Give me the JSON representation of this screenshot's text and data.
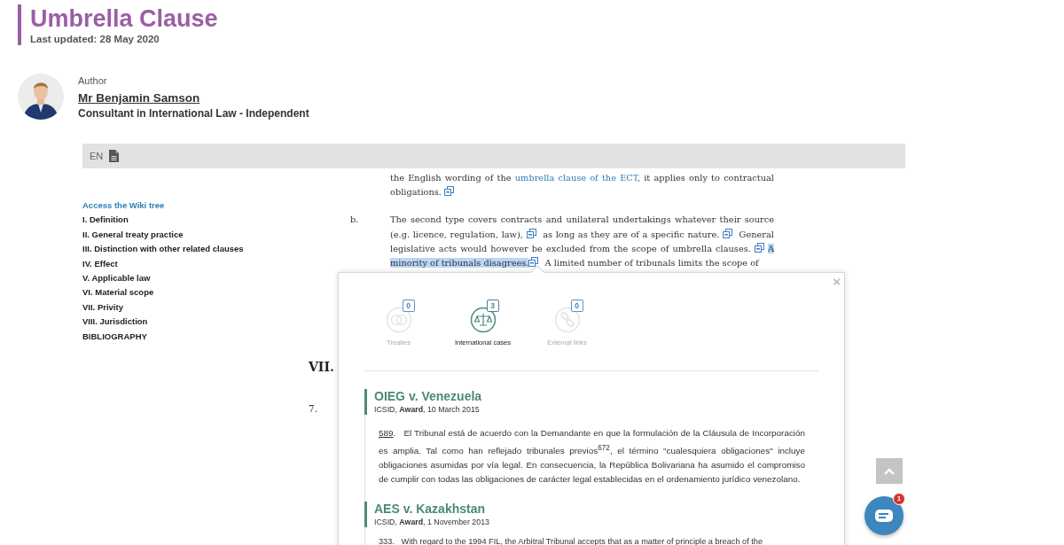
{
  "header": {
    "title": "Umbrella Clause",
    "updated": "Last updated: 28 May 2020"
  },
  "author": {
    "label": "Author",
    "name": "Mr Benjamin Samson",
    "role": "Consultant in International Law - Independent"
  },
  "toolbar": {
    "language": "EN"
  },
  "sidebar": {
    "tree_link": "Access the Wiki tree",
    "items": [
      "I. Definition",
      "II. General treaty practice",
      "III. Distinction with other related clauses",
      "IV. Effect",
      "V. Applicable law",
      "VI. Material scope",
      "VII. Privity",
      "VIII. Jurisdiction",
      "BIBLIOGRAPHY"
    ]
  },
  "content": {
    "paragraphs": [
      {
        "segments": [
          {
            "kind": "text",
            "text": "the English wording of the "
          },
          {
            "kind": "link",
            "text": "umbrella clause of the ECT"
          },
          {
            "kind": "text",
            "text": ", it applies only to contractual obligations. "
          },
          {
            "kind": "ref"
          }
        ]
      },
      {
        "marker": "b.",
        "segments": [
          {
            "kind": "text",
            "text": "The second type covers contracts and unilateral undertakings whatever their source (e.g. licence, regulation, law), "
          },
          {
            "kind": "ref"
          },
          {
            "kind": "text",
            "text": "  as long as they are of a specific nature. "
          },
          {
            "kind": "ref"
          },
          {
            "kind": "text",
            "text": "  General legislative acts would however be excluded from the scope of umbrella clauses. "
          },
          {
            "kind": "ref"
          },
          {
            "kind": "highlight",
            "text": "A minority of tribunals disagrees."
          },
          {
            "kind": "ref"
          },
          {
            "kind": "text",
            "text": "  A limited number of tribunals limits the scope of"
          }
        ]
      }
    ],
    "heading": "VII.",
    "next_marker": "7."
  },
  "popup": {
    "close": "×",
    "tabs": [
      {
        "kind": "treaties",
        "label": "Treaties",
        "count": "0",
        "selected": false
      },
      {
        "kind": "cases",
        "label": "International cases",
        "count": "3",
        "selected": true
      },
      {
        "kind": "links",
        "label": "External links",
        "count": "0",
        "selected": false
      }
    ],
    "cases": [
      {
        "title": "OIEG v. Venezuela",
        "meta": "ICSID, **Award**, 10 March 2015",
        "number": "589",
        "text": ".   El Tribunal está de acuerdo con la Demandante en que la formulación de la Cláusula de Incorporación es amplia. Tal como han reflejado tribunales previos$^{672}$, el término \"cualesquiera obligaciones\" incluye obligaciones asumidas por vía legal. En consecuencia, la República Bolivariana ha asumido el compromiso de cumplir con todas las obligaciones de carácter legal establecidas en el ordenamiento jurídico venezolano."
      },
      {
        "title": "AES v. Kazakhstan",
        "meta": "ICSID, **Award**, 1 November 2013",
        "number": "333",
        "text": ".   With regard to the 1994 FIL, the Arbitral Tribunal accepts that as a matter of principle a breach of the"
      }
    ]
  },
  "chat": {
    "badge": "1"
  }
}
